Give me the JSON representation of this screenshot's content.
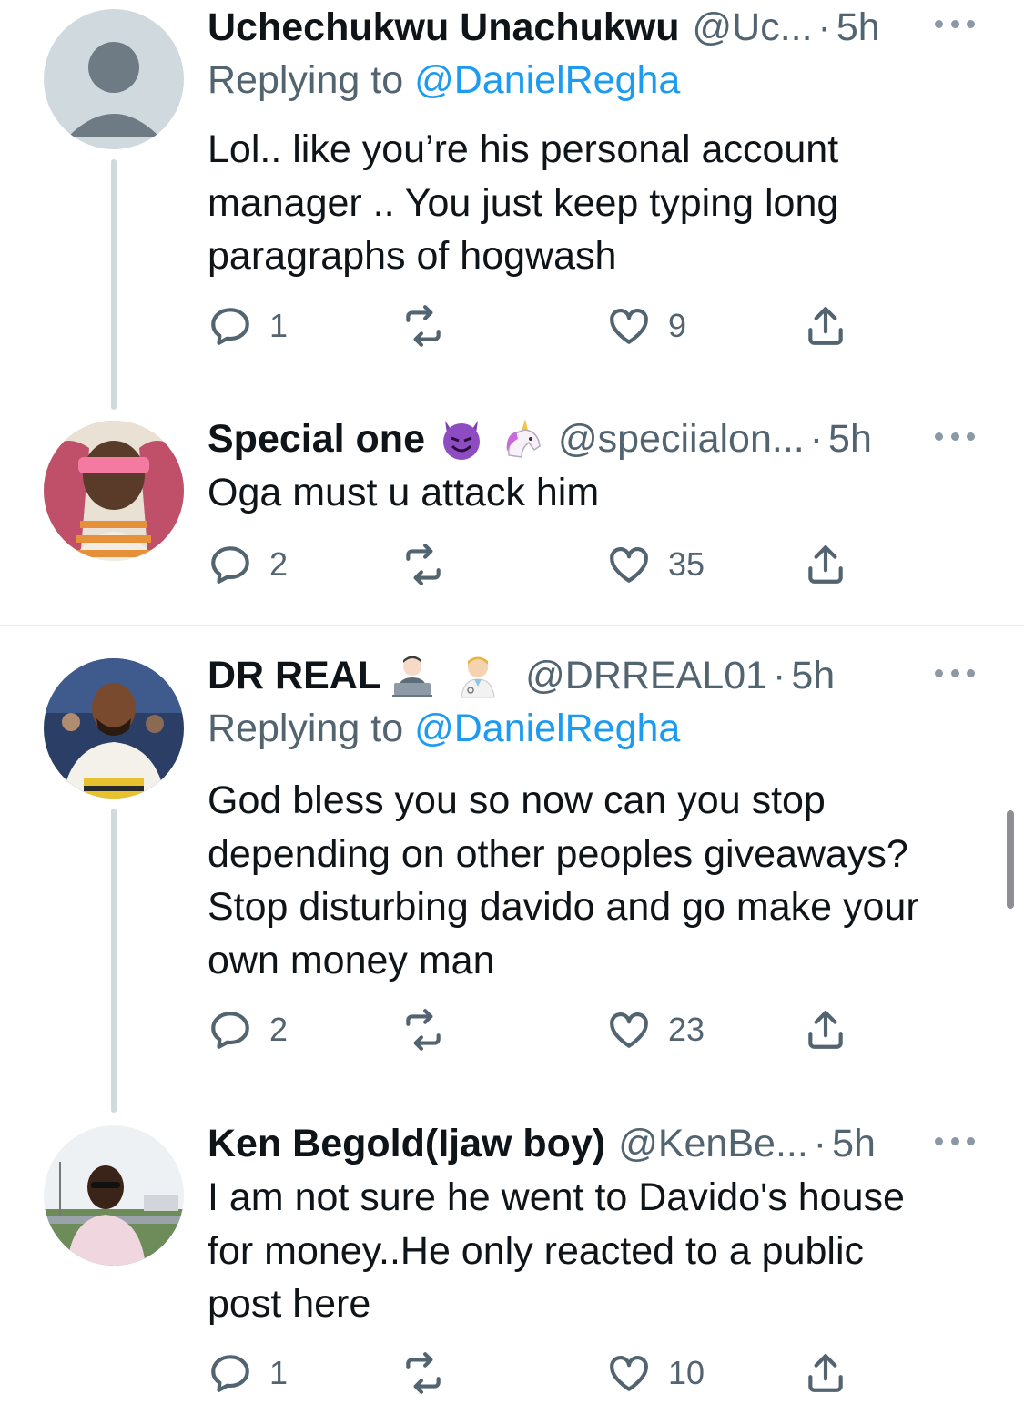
{
  "tweets": [
    {
      "name": "Uchechukwu Unachukwu",
      "handle": "@Uc...",
      "dot": "·",
      "time": "5h",
      "replying_label": "Replying to ",
      "replying_to": "@DanielRegha",
      "lines": [
        "Lol.. like you’re his personal account",
        "manager .. You just keep typing long",
        "paragraphs of hogwash"
      ],
      "replies": "1",
      "retweets": "",
      "likes": "9"
    },
    {
      "name": "Special one",
      "emojis": [
        "smiling-devil-emoji",
        "unicorn-emoji"
      ],
      "handle": "@speciialon...",
      "dot": "·",
      "time": "5h",
      "lines": [
        "Oga must u attack him"
      ],
      "replies": "2",
      "retweets": "",
      "likes": "35"
    },
    {
      "name": "DR REAL",
      "emojis": [
        "technologist-emoji",
        "health-worker-emoji"
      ],
      "handle": "@DRREAL01",
      "dot": "·",
      "time": "5h",
      "replying_label": "Replying to ",
      "replying_to": "@DanielRegha",
      "lines": [
        "God bless you so now can you stop",
        "depending on other peoples giveaways?",
        "Stop disturbing davido and go make your",
        "own money man"
      ],
      "replies": "2",
      "retweets": "",
      "likes": "23"
    },
    {
      "name": "Ken Begold(Ijaw boy)",
      "handle": "@KenBe...",
      "dot": "·",
      "time": "5h",
      "lines": [
        "I am not sure he went to Davido's house",
        "for money..He only reacted to a public",
        "post here"
      ],
      "replies": "1",
      "retweets": "",
      "likes": "10"
    }
  ],
  "colors": {
    "text": "#0f1419",
    "secondary": "#536471",
    "link": "#1d9bf0",
    "thread": "#cfd9de"
  },
  "icons": [
    "reply-icon",
    "retweet-icon",
    "like-icon",
    "share-icon",
    "more-icon"
  ]
}
